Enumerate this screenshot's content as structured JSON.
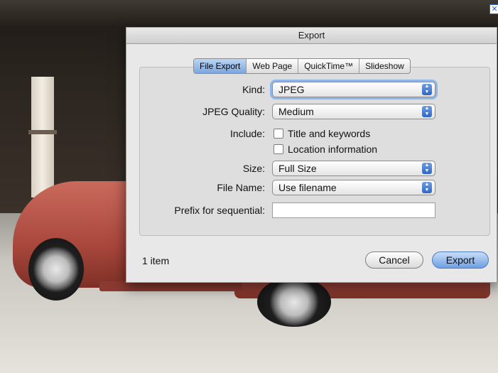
{
  "background": {
    "close_glyph": "✕"
  },
  "dialog": {
    "title": "Export",
    "tabs": [
      {
        "label": "File Export",
        "active": true
      },
      {
        "label": "Web Page",
        "active": false
      },
      {
        "label": "QuickTime™",
        "active": false
      },
      {
        "label": "Slideshow",
        "active": false
      }
    ],
    "kind": {
      "label": "Kind:",
      "value": "JPEG"
    },
    "jpeg_quality": {
      "label": "JPEG Quality:",
      "value": "Medium"
    },
    "include": {
      "label": "Include:",
      "options": [
        {
          "label": "Title and keywords",
          "checked": false
        },
        {
          "label": "Location information",
          "checked": false
        }
      ]
    },
    "size": {
      "label": "Size:",
      "value": "Full Size"
    },
    "file_name": {
      "label": "File Name:",
      "value": "Use filename"
    },
    "prefix": {
      "label": "Prefix for sequential:",
      "value": ""
    },
    "footer": {
      "item_count": "1 item",
      "cancel_label": "Cancel",
      "export_label": "Export"
    }
  },
  "colors": {
    "accent": "#6f9fe2",
    "truck": "#a9473c"
  }
}
